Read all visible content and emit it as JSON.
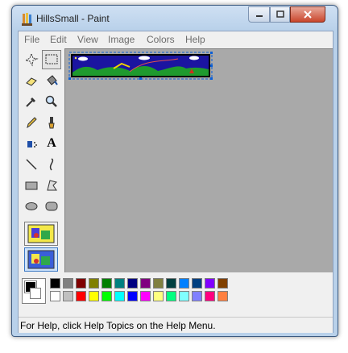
{
  "window": {
    "title": "HillsSmall - Paint"
  },
  "menu": [
    "File",
    "Edit",
    "View",
    "Image",
    "Colors",
    "Help"
  ],
  "tools": [
    {
      "name": "free-form-select-icon"
    },
    {
      "name": "rect-select-icon"
    },
    {
      "name": "eraser-icon"
    },
    {
      "name": "fill-bucket-icon"
    },
    {
      "name": "color-picker-icon"
    },
    {
      "name": "magnifier-icon"
    },
    {
      "name": "pencil-icon"
    },
    {
      "name": "brush-icon"
    },
    {
      "name": "airbrush-icon"
    },
    {
      "name": "text-icon",
      "glyph": "A"
    },
    {
      "name": "line-icon"
    },
    {
      "name": "curve-icon"
    },
    {
      "name": "rectangle-icon"
    },
    {
      "name": "polygon-icon"
    },
    {
      "name": "ellipse-icon"
    },
    {
      "name": "rounded-rect-icon"
    }
  ],
  "palette": {
    "row1": [
      "#000000",
      "#808080",
      "#800000",
      "#808000",
      "#008000",
      "#008080",
      "#000080",
      "#800080",
      "#808040",
      "#004040",
      "#0080ff",
      "#004080",
      "#8000ff",
      "#804000"
    ],
    "row2": [
      "#ffffff",
      "#c0c0c0",
      "#ff0000",
      "#ffff00",
      "#00ff00",
      "#00ffff",
      "#0000ff",
      "#ff00ff",
      "#ffff80",
      "#00ff80",
      "#80ffff",
      "#8080ff",
      "#ff0080",
      "#ff8040"
    ]
  },
  "status": {
    "text": "For Help, click Help Topics on the Help Menu."
  },
  "colors": {
    "canvas_bg": "#a9a9a9",
    "selection_accent": "#0b5fd7"
  }
}
